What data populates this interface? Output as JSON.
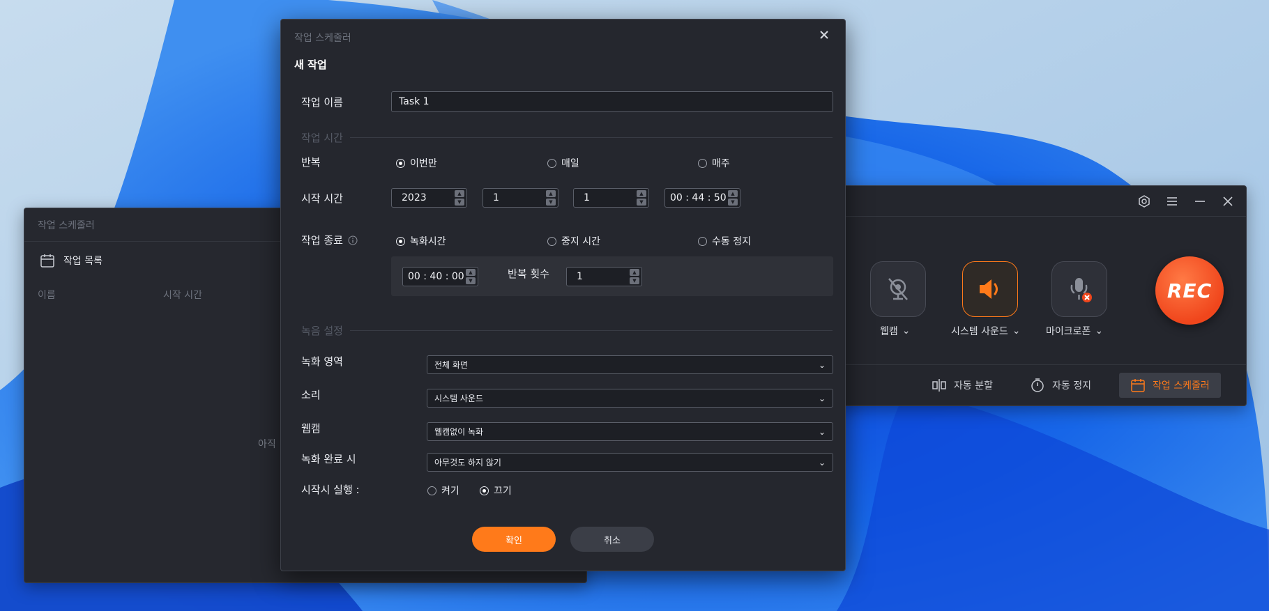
{
  "background_window": {
    "title": "작업 스케줄러",
    "task_list_label": "작업 목록",
    "columns": [
      "이름",
      "시작 시간"
    ],
    "empty_text": "아직"
  },
  "recorder": {
    "sources": [
      {
        "label": "웹캠",
        "icon": "webcam-off-icon",
        "active": false
      },
      {
        "label": "시스템 사운드",
        "icon": "speaker-icon",
        "active": true
      },
      {
        "label": "마이크로폰",
        "icon": "microphone-off-icon",
        "active": false
      }
    ],
    "rec_label": "REC",
    "tools": [
      {
        "label": "자동 분할",
        "icon": "split-icon"
      },
      {
        "label": "자동 정지",
        "icon": "timer-icon"
      },
      {
        "label": "작업 스케줄러",
        "icon": "calendar-icon",
        "active": true
      }
    ],
    "colors": {
      "accent": "#ff7a1a",
      "rec": "#f0461c"
    }
  },
  "dialog": {
    "title": "작업 스케줄러",
    "subtitle": "새 작업",
    "task_name": {
      "label": "작업 이름",
      "value": "Task 1"
    },
    "section_time": "작업 시간",
    "repeat": {
      "label": "반복",
      "options": [
        "이번만",
        "매일",
        "매주"
      ],
      "selected": 0
    },
    "start_time": {
      "label": "시작 시간",
      "year": "2023",
      "month": "1",
      "day": "1",
      "time": "00 : 44 : 50"
    },
    "end": {
      "label": "작업 종료",
      "options": [
        "녹화시간",
        "중지 시간",
        "수동 정지"
      ],
      "selected": 0
    },
    "duration": "00 : 40 : 00",
    "repeat_count": {
      "label": "반복 횟수",
      "value": "1"
    },
    "section_record": "녹음 설정",
    "fields": [
      {
        "label": "녹화 영역",
        "value": "전체 화면"
      },
      {
        "label": "소리",
        "value": "시스템 사운드"
      },
      {
        "label": "웹캠",
        "value": "웹캠없이 녹화"
      },
      {
        "label": "녹화 완료 시",
        "value": "아무것도 하지 않기"
      }
    ],
    "run_on_start": {
      "label": "시작시 실행 :",
      "options": [
        "켜기",
        "끄기"
      ],
      "selected": 1
    },
    "ok": "확인",
    "cancel": "취소"
  }
}
